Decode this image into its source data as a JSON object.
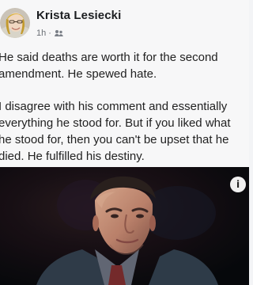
{
  "post": {
    "author_name": "Krista Lesiecki",
    "time": "1h ·",
    "paragraphs": [
      {
        "lines": [
          "He said deaths are worth it for the second",
          "amendment.  He spewed hate."
        ]
      },
      {
        "lines": [
          "I disagree with his comment and essentially",
          "everything he stood for.  But if you liked what",
          "he stood for, then you can't be upset that he",
          "died.  He fulfilled his destiny."
        ]
      }
    ],
    "overlay_badge": "i"
  },
  "icons": {
    "avatar": "profile-photo",
    "audience": "friends-icon",
    "more": "info-icon"
  },
  "colors": {
    "text": "#222222",
    "meta": "#6b6f76",
    "photo_background": "#090b10"
  }
}
